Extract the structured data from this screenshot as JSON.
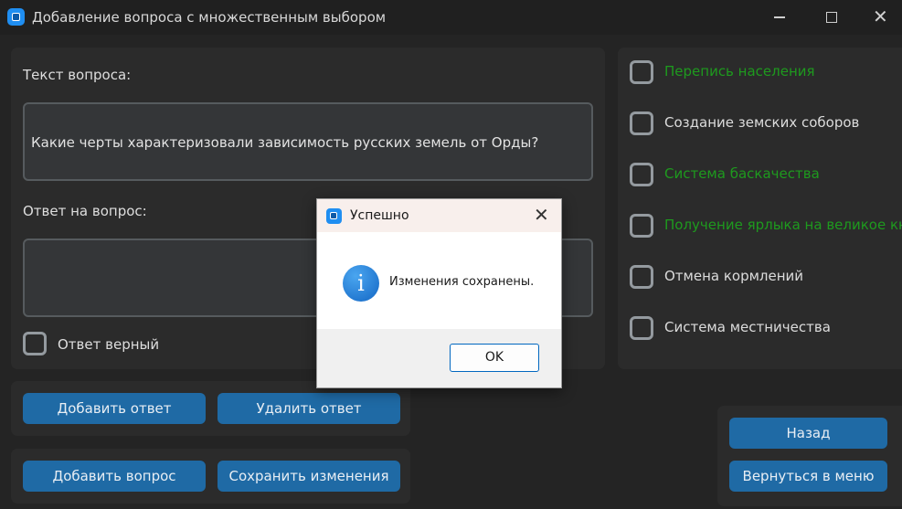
{
  "window": {
    "title": "Добавление вопроса с множественным выбором",
    "icon": "app-icon",
    "controls": [
      "minimize-icon",
      "maximize-icon",
      "close-icon"
    ]
  },
  "question": {
    "label": "Текст вопроса:",
    "text": "Какие черты характеризовали зависимость русских земель от Орды?"
  },
  "answer": {
    "label": "Ответ на вопрос:",
    "value": "",
    "correct_label": "Ответ верный"
  },
  "buttons": {
    "add_answer": "Добавить ответ",
    "delete_answer": "Удалить ответ",
    "add_question": "Добавить вопрос",
    "save_changes": "Сохранить изменения",
    "back": "Назад",
    "return_menu": "Вернуться в меню"
  },
  "options": [
    {
      "label": "Перепись населения",
      "correct": true
    },
    {
      "label": "Создание земских соборов",
      "correct": false
    },
    {
      "label": "Система баскачества",
      "correct": true
    },
    {
      "label": "Получение ярлыка на великое кн",
      "correct": true
    },
    {
      "label": "Отмена кормлений",
      "correct": false
    },
    {
      "label": "Система местничества",
      "correct": false
    }
  ],
  "colors": {
    "correct": "#1e9a1e",
    "normal": "#dcdcdc",
    "accent": "#1f6aa5"
  },
  "dialog": {
    "title": "Успешно",
    "message": "Изменения сохранены.",
    "ok": "OK",
    "icon": "info-icon"
  }
}
